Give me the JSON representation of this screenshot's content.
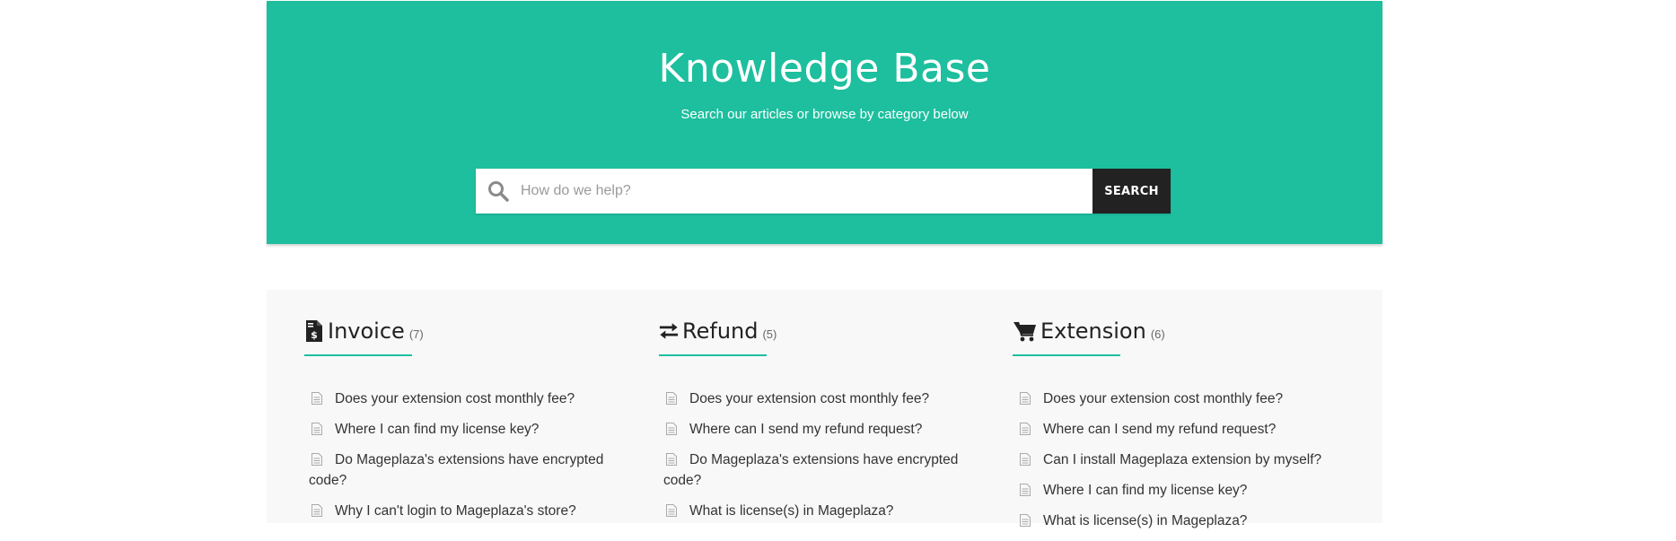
{
  "hero": {
    "title": "Knowledge Base",
    "subtitle": "Search our articles or browse by category below",
    "accent_color": "#1dbf9e"
  },
  "search": {
    "placeholder": "How do we help?",
    "value": "",
    "button_label": "SEARCH",
    "icon": "search-icon"
  },
  "categories": [
    {
      "title": "Invoice",
      "count": "(7)",
      "icon": "invoice-icon",
      "articles": [
        "Does your extension cost monthly fee?",
        "Where I can find my license key?",
        "Do Mageplaza's extensions have encrypted code?",
        "Why I can't login to Mageplaza's store?"
      ]
    },
    {
      "title": "Refund",
      "count": "(5)",
      "icon": "exchange-arrows-icon",
      "articles": [
        "Does your extension cost monthly fee?",
        "Where can I send my refund request?",
        "Do Mageplaza's extensions have encrypted code?",
        "What is license(s) in Mageplaza?"
      ]
    },
    {
      "title": "Extension",
      "count": "(6)",
      "icon": "shopping-cart-icon",
      "articles": [
        "Does your extension cost monthly fee?",
        "Where can I send my refund request?",
        "Can I install Mageplaza extension by myself?",
        "Where I can find my license key?",
        "What is license(s) in Mageplaza?"
      ]
    }
  ]
}
